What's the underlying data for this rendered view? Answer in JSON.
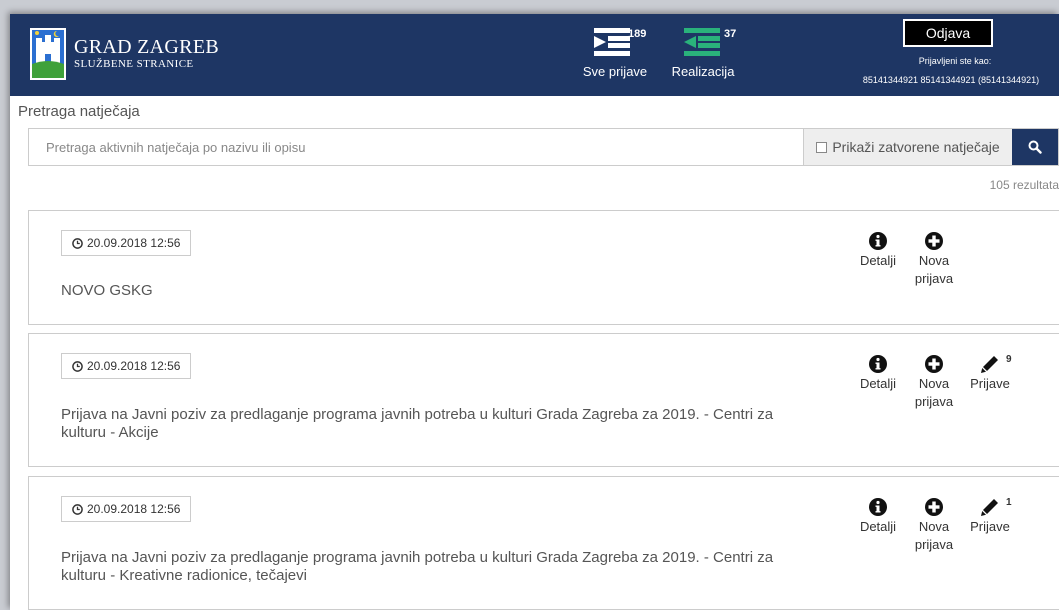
{
  "header": {
    "brand_title": "GRAD ZAGREB",
    "brand_subtitle": "SLUŽBENE STRANICE",
    "stats": [
      {
        "label": "Sve prijave",
        "count": "189",
        "icon": "list-right-icon"
      },
      {
        "label": "Realizacija",
        "count": "37",
        "icon": "list-left-icon"
      }
    ],
    "logout_label": "Odjava",
    "logged_caption": "Prijavljeni ste kao:",
    "logged_user": "85141344921 85141344921 (85141344921)"
  },
  "search": {
    "title": "Pretraga natječaja",
    "placeholder": "Pretraga aktivnih natječaja po nazivu ili opisu",
    "closed_toggle_label": "Prikaži zatvorene natječaje",
    "results_count": "105 rezultata"
  },
  "actions": {
    "details_label": "Detalji",
    "new_line1": "Nova",
    "new_line2": "prijava",
    "applications_label": "Prijave"
  },
  "cards": [
    {
      "date": "20.09.2018 12:56",
      "title": "NOVO GSKG",
      "applications_count": ""
    },
    {
      "date": "20.09.2018 12:56",
      "title": "Prijava na Javni poziv za predlaganje programa javnih potreba u kulturi Grada Zagreba za 2019. - Centri za kulturu - Akcije",
      "applications_count": "9"
    },
    {
      "date": "20.09.2018 12:56",
      "title": "Prijava na Javni poziv za predlaganje programa javnih potreba u kulturi Grada Zagreba za 2019. - Centri za kulturu - Kreativne radionice, tečajevi",
      "applications_count": "1"
    }
  ],
  "colors": {
    "header_bg": "#1e3664",
    "accent": "#1e3664",
    "stat_icon_green": "#2ab27b"
  }
}
